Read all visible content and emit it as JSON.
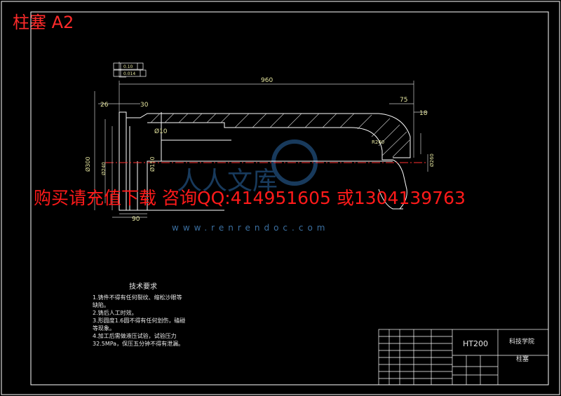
{
  "sheet": {
    "label": "柱塞 A2",
    "watermark": "购买请充值下载 咨询QQ:414951605 或1304139763",
    "watermark_url": "www.renrendoc.com",
    "watermark_logo": "人人文库"
  },
  "drawing": {
    "dims": {
      "overall_length": "960",
      "right_len": "75",
      "right_small": "18",
      "left_26": "26",
      "left_30": "30",
      "d_large": "Ø300",
      "d_mid": "Ø240",
      "d_in": "Ø150",
      "d_small": "Ø10",
      "bottom_90": "90",
      "tol_1": "0.10",
      "tol_2": "0.014",
      "r_label": "R260",
      "d_right": "Ø260"
    }
  },
  "tech_requirements": {
    "heading": "技术要求",
    "lines": [
      "1.铸件不得有任何裂纹、缩松沙眼等",
      "缺陷。",
      "2.铸后人工时效。",
      "3.形圆度1.6圆不得有任何划伤，磕碰",
      "等现象。",
      "4.加工后需做液压试验，试验压力",
      "32.5MPa，保压五分钟不得有泄漏。"
    ]
  },
  "title_block": {
    "material": "HT200",
    "school": "科技学院",
    "part_name": "柱塞"
  }
}
